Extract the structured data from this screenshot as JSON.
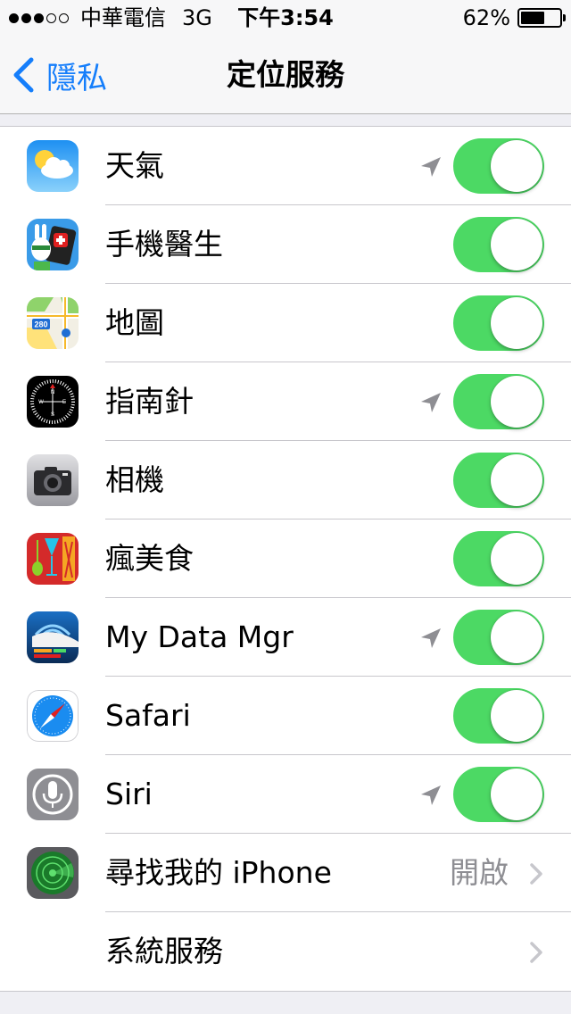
{
  "status_bar": {
    "carrier": "中華電信",
    "network": "3G",
    "time": "下午3:54",
    "battery_text": "62%",
    "battery_level": 0.62,
    "signal_bars_filled": 3,
    "signal_bars_total": 5
  },
  "nav": {
    "back_label": "隱私",
    "title": "定位服務"
  },
  "colors": {
    "accent": "#157efb",
    "toggle_on": "#4cd964",
    "value_gray": "#8e8e93",
    "separator": "#c8c7cc"
  },
  "apps": [
    {
      "label": "天氣",
      "icon": "weather-icon",
      "location_used": true,
      "enabled": true
    },
    {
      "label": "手機醫生",
      "icon": "phone-doctor-icon",
      "location_used": false,
      "enabled": true
    },
    {
      "label": "地圖",
      "icon": "maps-icon",
      "location_used": false,
      "enabled": true
    },
    {
      "label": "指南針",
      "icon": "compass-icon",
      "location_used": true,
      "enabled": true
    },
    {
      "label": "相機",
      "icon": "camera-icon",
      "location_used": false,
      "enabled": true
    },
    {
      "label": "瘋美食",
      "icon": "food-app-icon",
      "location_used": false,
      "enabled": true
    },
    {
      "label": "My Data Mgr",
      "icon": "data-manager-icon",
      "location_used": true,
      "enabled": true
    },
    {
      "label": "Safari",
      "icon": "safari-icon",
      "location_used": false,
      "enabled": true
    },
    {
      "label": "Siri",
      "icon": "siri-icon",
      "location_used": true,
      "enabled": true
    }
  ],
  "find_iphone": {
    "label": "尋找我的 iPhone",
    "value": "開啟",
    "icon": "find-my-iphone-icon"
  },
  "system_services": {
    "label": "系統服務"
  },
  "maps_badge": "280",
  "compass_letters": {
    "n": "N",
    "s": "S",
    "e": "E",
    "w": "W"
  }
}
